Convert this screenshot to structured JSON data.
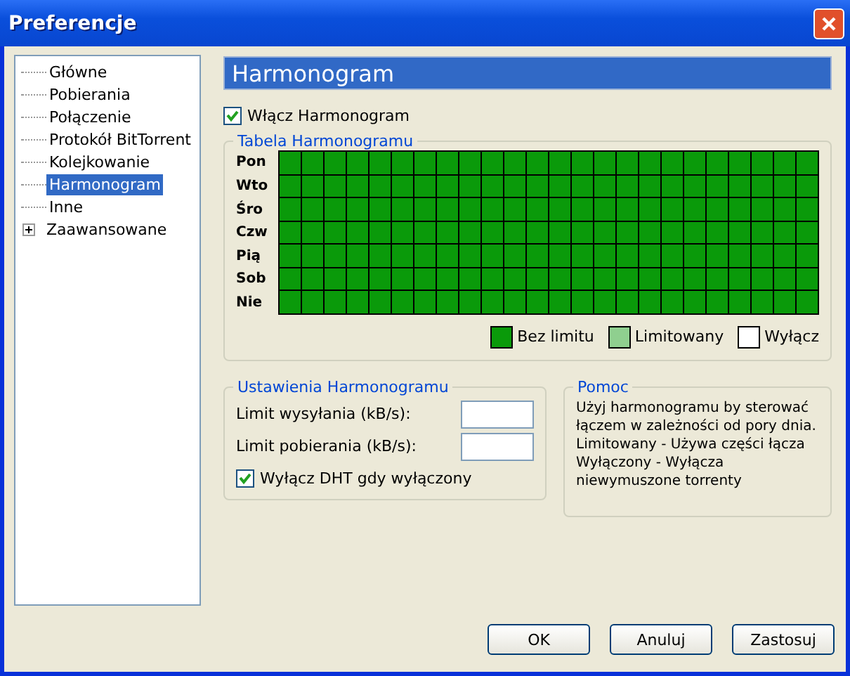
{
  "window": {
    "title": "Preferencje"
  },
  "sidebar": {
    "items": [
      {
        "label": "Główne",
        "selected": false
      },
      {
        "label": "Pobierania",
        "selected": false
      },
      {
        "label": "Połączenie",
        "selected": false
      },
      {
        "label": "Protokół BitTorrent",
        "selected": false
      },
      {
        "label": "Kolejkowanie",
        "selected": false
      },
      {
        "label": "Harmonogram",
        "selected": true
      },
      {
        "label": "Inne",
        "selected": false
      },
      {
        "label": "Zaawansowane",
        "selected": false,
        "expanded": false
      }
    ]
  },
  "page_title": "Harmonogram",
  "enable": {
    "label": "Włącz Harmonogram",
    "checked": true
  },
  "schedule": {
    "title": "Tabela Harmonogramu",
    "rows": [
      {
        "day": "Pon",
        "cells": [
          {
            "kind": "full"
          },
          {
            "kind": "full"
          },
          {
            "kind": "full"
          },
          {
            "kind": "full"
          },
          {
            "kind": "full"
          },
          {
            "kind": "full"
          },
          {
            "kind": "full"
          },
          {
            "kind": "full"
          },
          {
            "kind": "full"
          },
          {
            "kind": "full"
          },
          {
            "kind": "full"
          },
          {
            "kind": "full"
          },
          {
            "kind": "full"
          },
          {
            "kind": "full"
          },
          {
            "kind": "full"
          },
          {
            "kind": "full"
          },
          {
            "kind": "full"
          },
          {
            "kind": "full"
          },
          {
            "kind": "full"
          },
          {
            "kind": "full"
          },
          {
            "kind": "full"
          },
          {
            "kind": "full"
          },
          {
            "kind": "full"
          },
          {
            "kind": "full"
          }
        ]
      },
      {
        "day": "Wto",
        "cells": [
          {
            "kind": "full"
          },
          {
            "kind": "full"
          },
          {
            "kind": "full"
          },
          {
            "kind": "full"
          },
          {
            "kind": "full"
          },
          {
            "kind": "full"
          },
          {
            "kind": "full"
          },
          {
            "kind": "full"
          },
          {
            "kind": "full"
          },
          {
            "kind": "full"
          },
          {
            "kind": "full"
          },
          {
            "kind": "full"
          },
          {
            "kind": "full"
          },
          {
            "kind": "full"
          },
          {
            "kind": "full"
          },
          {
            "kind": "full"
          },
          {
            "kind": "full"
          },
          {
            "kind": "full"
          },
          {
            "kind": "full"
          },
          {
            "kind": "full"
          },
          {
            "kind": "full"
          },
          {
            "kind": "full"
          },
          {
            "kind": "full"
          },
          {
            "kind": "full"
          }
        ]
      },
      {
        "day": "Śro",
        "cells": [
          {
            "kind": "full"
          },
          {
            "kind": "full"
          },
          {
            "kind": "full"
          },
          {
            "kind": "full"
          },
          {
            "kind": "full"
          },
          {
            "kind": "full"
          },
          {
            "kind": "full"
          },
          {
            "kind": "full"
          },
          {
            "kind": "full"
          },
          {
            "kind": "full"
          },
          {
            "kind": "full"
          },
          {
            "kind": "full"
          },
          {
            "kind": "full"
          },
          {
            "kind": "full"
          },
          {
            "kind": "full"
          },
          {
            "kind": "full"
          },
          {
            "kind": "full"
          },
          {
            "kind": "full"
          },
          {
            "kind": "full"
          },
          {
            "kind": "full"
          },
          {
            "kind": "full"
          },
          {
            "kind": "full"
          },
          {
            "kind": "full"
          },
          {
            "kind": "full"
          }
        ]
      },
      {
        "day": "Czw",
        "cells": [
          {
            "kind": "full"
          },
          {
            "kind": "full"
          },
          {
            "kind": "full"
          },
          {
            "kind": "full"
          },
          {
            "kind": "full"
          },
          {
            "kind": "full"
          },
          {
            "kind": "full"
          },
          {
            "kind": "full"
          },
          {
            "kind": "full"
          },
          {
            "kind": "full"
          },
          {
            "kind": "full"
          },
          {
            "kind": "full"
          },
          {
            "kind": "full"
          },
          {
            "kind": "full"
          },
          {
            "kind": "full"
          },
          {
            "kind": "full"
          },
          {
            "kind": "full"
          },
          {
            "kind": "full"
          },
          {
            "kind": "full"
          },
          {
            "kind": "full"
          },
          {
            "kind": "full"
          },
          {
            "kind": "full"
          },
          {
            "kind": "full"
          },
          {
            "kind": "full"
          }
        ]
      },
      {
        "day": "Pią",
        "cells": [
          {
            "kind": "full"
          },
          {
            "kind": "full"
          },
          {
            "kind": "full"
          },
          {
            "kind": "full"
          },
          {
            "kind": "full"
          },
          {
            "kind": "full"
          },
          {
            "kind": "full"
          },
          {
            "kind": "full"
          },
          {
            "kind": "full"
          },
          {
            "kind": "full"
          },
          {
            "kind": "full"
          },
          {
            "kind": "full"
          },
          {
            "kind": "full"
          },
          {
            "kind": "full"
          },
          {
            "kind": "full"
          },
          {
            "kind": "full"
          },
          {
            "kind": "full"
          },
          {
            "kind": "full"
          },
          {
            "kind": "full"
          },
          {
            "kind": "full"
          },
          {
            "kind": "full"
          },
          {
            "kind": "full"
          },
          {
            "kind": "full"
          },
          {
            "kind": "full"
          }
        ]
      },
      {
        "day": "Sob",
        "cells": [
          {
            "kind": "full"
          },
          {
            "kind": "full"
          },
          {
            "kind": "full"
          },
          {
            "kind": "full"
          },
          {
            "kind": "full"
          },
          {
            "kind": "full"
          },
          {
            "kind": "full"
          },
          {
            "kind": "full"
          },
          {
            "kind": "full"
          },
          {
            "kind": "full"
          },
          {
            "kind": "full"
          },
          {
            "kind": "full"
          },
          {
            "kind": "full"
          },
          {
            "kind": "full"
          },
          {
            "kind": "full"
          },
          {
            "kind": "full"
          },
          {
            "kind": "full"
          },
          {
            "kind": "full"
          },
          {
            "kind": "full"
          },
          {
            "kind": "full"
          },
          {
            "kind": "full"
          },
          {
            "kind": "full"
          },
          {
            "kind": "full"
          },
          {
            "kind": "full"
          }
        ]
      },
      {
        "day": "Nie",
        "cells": [
          {
            "kind": "full"
          },
          {
            "kind": "full"
          },
          {
            "kind": "full"
          },
          {
            "kind": "full"
          },
          {
            "kind": "full"
          },
          {
            "kind": "full"
          },
          {
            "kind": "full"
          },
          {
            "kind": "full"
          },
          {
            "kind": "full"
          },
          {
            "kind": "full"
          },
          {
            "kind": "full"
          },
          {
            "kind": "full"
          },
          {
            "kind": "full"
          },
          {
            "kind": "full"
          },
          {
            "kind": "full"
          },
          {
            "kind": "full"
          },
          {
            "kind": "full"
          },
          {
            "kind": "full"
          },
          {
            "kind": "full"
          },
          {
            "kind": "full"
          },
          {
            "kind": "full"
          },
          {
            "kind": "full"
          },
          {
            "kind": "full"
          },
          {
            "kind": "full"
          }
        ]
      }
    ],
    "legend": [
      {
        "kind": "full",
        "label": "Bez limitu"
      },
      {
        "kind": "limited",
        "label": "Limitowany"
      },
      {
        "kind": "off",
        "label": "Wyłącz"
      }
    ]
  },
  "settings": {
    "title": "Ustawienia Harmonogramu",
    "fields": [
      {
        "label": "Limit wysyłania (kB/s):"
      },
      {
        "label": "Limit pobierania (kB/s):"
      }
    ],
    "dht": {
      "label": "Wyłącz DHT gdy wyłączony",
      "checked": true
    }
  },
  "help": {
    "title": "Pomoc",
    "text": "Użyj harmonogramu by sterować łączem w zależności od pory dnia. Limitowany - Używa części łącza Wyłączony - Wyłącza niewymuszone torrenty"
  },
  "buttons": [
    "OK",
    "Anuluj",
    "Zastosuj"
  ]
}
